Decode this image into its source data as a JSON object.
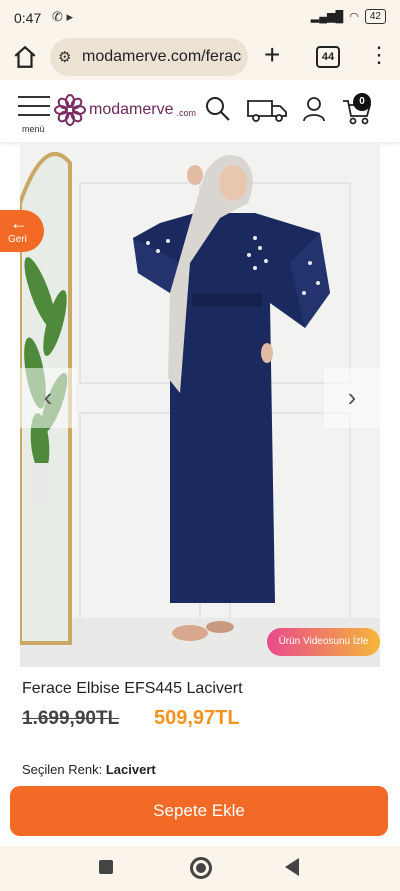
{
  "status": {
    "time": "0:47",
    "battery": "42"
  },
  "browser": {
    "url": "modamerve.com/ferace",
    "tab_count": "44"
  },
  "header": {
    "menu_label": "menü",
    "brand": "modamerve",
    "brand_suffix": ".com",
    "cart_count": "0"
  },
  "product": {
    "back_label": "Geri",
    "video_label": "Ürün Videosunu İzle",
    "title": "Ferace Elbise EFS445 Lacivert",
    "old_price": "1.699,90TL",
    "new_price": "509,97TL",
    "selected_color_label": "Seçilen Renk:",
    "selected_color": "Lacivert",
    "add_to_cart": "Sepete Ekle"
  },
  "colors": {
    "accent": "#f26a26",
    "price": "#f39221",
    "dress": "#1b2a5e"
  }
}
